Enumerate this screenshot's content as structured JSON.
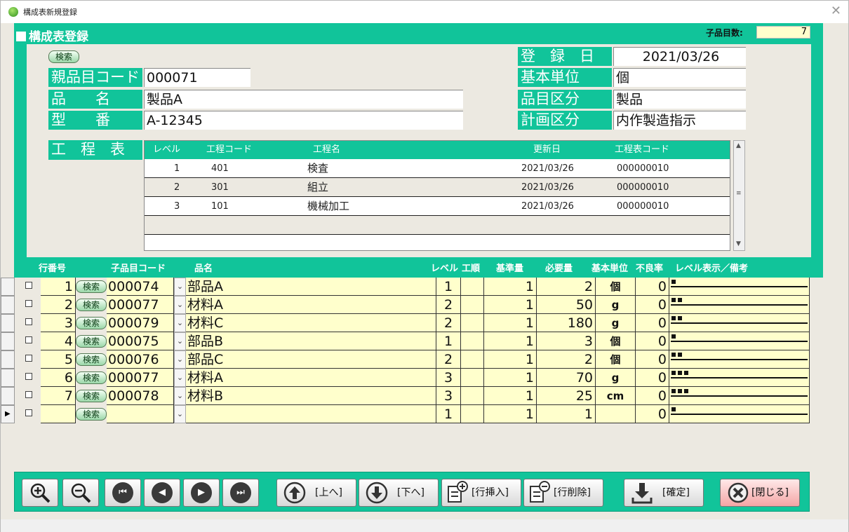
{
  "window": {
    "title": "構成表新規登録",
    "close_glyph": "✕"
  },
  "form": {
    "title": "構成表登録",
    "child_count_label": "子品目数:",
    "child_count": "7"
  },
  "header": {
    "search_label": "検索",
    "parent_code_label": "親品目コード",
    "parent_code": "000071",
    "name_label": "品　　名",
    "name": "製品A",
    "model_label": "型　　番",
    "model": "A-12345",
    "reg_date_label": "登　録　日",
    "reg_date": "2021/03/26",
    "base_unit_label": "基本単位",
    "base_unit": "個",
    "item_class_label": "品目区分",
    "item_class": "製品",
    "plan_class_label": "計画区分",
    "plan_class": "内作製造指示",
    "process_table_label": "工　程　表"
  },
  "process_grid": {
    "columns": [
      "レベル",
      "工程コード",
      "工程名",
      "更新日",
      "工程表コード"
    ],
    "rows": [
      {
        "level": "1",
        "code": "401",
        "name": "検査",
        "date": "2021/03/26",
        "table_code": "000000010"
      },
      {
        "level": "2",
        "code": "301",
        "name": "組立",
        "date": "2021/03/26",
        "table_code": "000000010"
      },
      {
        "level": "3",
        "code": "101",
        "name": "機械加工",
        "date": "2021/03/26",
        "table_code": "000000010"
      }
    ]
  },
  "detail": {
    "columns": {
      "row_no": "行番号",
      "child_code": "子品目コード",
      "name": "品名",
      "level": "レベル",
      "proc": "工順",
      "base_qty": "基準量",
      "req_qty": "必要量",
      "unit": "基本単位",
      "defect": "不良率",
      "level_note": "レベル表示／備考"
    },
    "search_label": "検索",
    "rows": [
      {
        "no": "1",
        "code": "000074",
        "name": "部品A",
        "level": "1",
        "base": "1",
        "req": "2",
        "unit": "個",
        "defect": "0"
      },
      {
        "no": "2",
        "code": "000077",
        "name": "材料A",
        "level": "2",
        "base": "1",
        "req": "50",
        "unit": "g",
        "defect": "0"
      },
      {
        "no": "3",
        "code": "000079",
        "name": "材料C",
        "level": "2",
        "base": "1",
        "req": "180",
        "unit": "g",
        "defect": "0"
      },
      {
        "no": "4",
        "code": "000075",
        "name": "部品B",
        "level": "1",
        "base": "1",
        "req": "3",
        "unit": "個",
        "defect": "0"
      },
      {
        "no": "5",
        "code": "000076",
        "name": "部品C",
        "level": "2",
        "base": "1",
        "req": "2",
        "unit": "個",
        "defect": "0"
      },
      {
        "no": "6",
        "code": "000077",
        "name": "材料A",
        "level": "3",
        "base": "1",
        "req": "70",
        "unit": "g",
        "defect": "0"
      },
      {
        "no": "7",
        "code": "000078",
        "name": "材料B",
        "level": "3",
        "base": "1",
        "req": "25",
        "unit": "cm",
        "defect": "0"
      },
      {
        "no": "",
        "code": "",
        "name": "",
        "level": "1",
        "base": "1",
        "req": "1",
        "unit": "",
        "defect": "0"
      }
    ],
    "current_row_marker": "▶"
  },
  "toolbar": {
    "up_label": "[上へ]",
    "down_label": "[下へ]",
    "insert_label": "[行挿入]",
    "delete_label": "[行削除]",
    "confirm_label": "[確定]",
    "close_label": "[閉じる]"
  }
}
